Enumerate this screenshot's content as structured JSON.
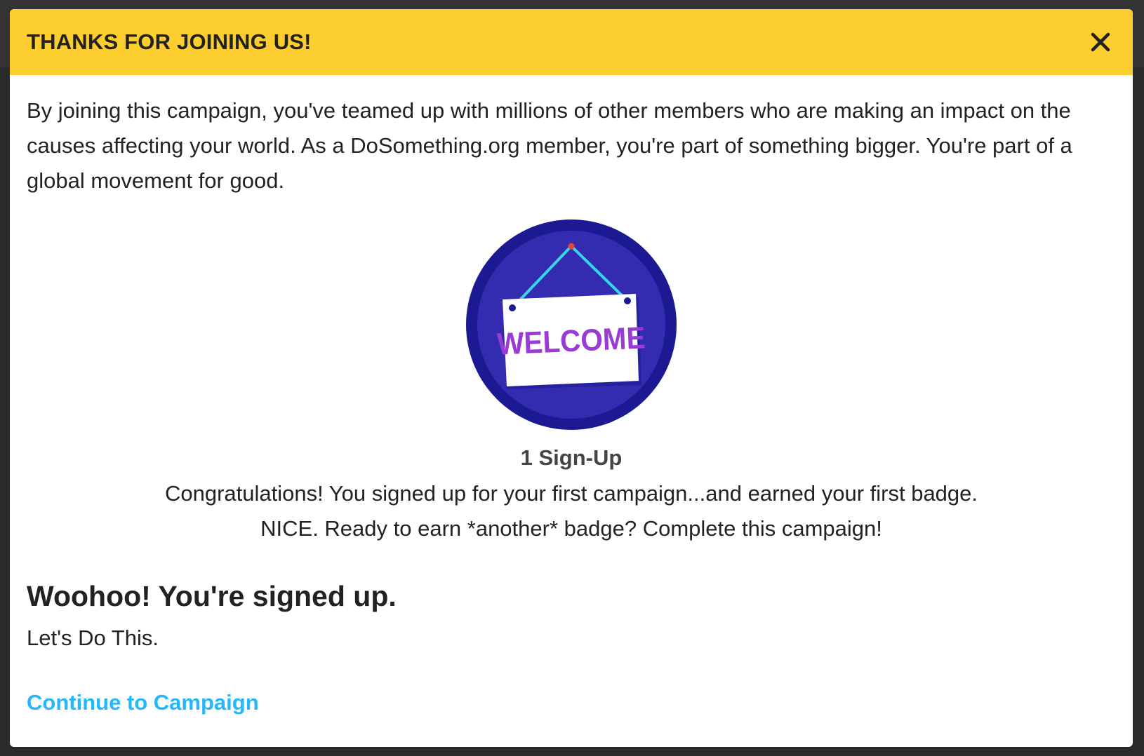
{
  "modal": {
    "title": "THANKS FOR JOINING US!",
    "close_icon": "close-icon",
    "intro": "By joining this campaign, you've teamed up with millions of other members who are making an impact on the causes affecting your world. As a DoSomething.org member, you're part of something bigger. You're part of a global movement for good."
  },
  "badge": {
    "icon": "welcome-sign-badge-icon",
    "sign_text": "WELCOME",
    "title": "1 Sign-Up",
    "description": "Congratulations! You signed up for your first campaign...and earned your first badge. NICE. Ready to earn *another* badge? Complete this campaign!"
  },
  "signup": {
    "heading": "Woohoo! You're signed up.",
    "subheading": "Let's Do This.",
    "continue_label": "Continue to Campaign"
  },
  "colors": {
    "header_bg": "#fccd2e",
    "badge_outer": "#1b1a93",
    "badge_inner": "#332cb0",
    "sign_text": "#9b3bd6",
    "string": "#36d6e7",
    "link": "#23b7fb"
  }
}
